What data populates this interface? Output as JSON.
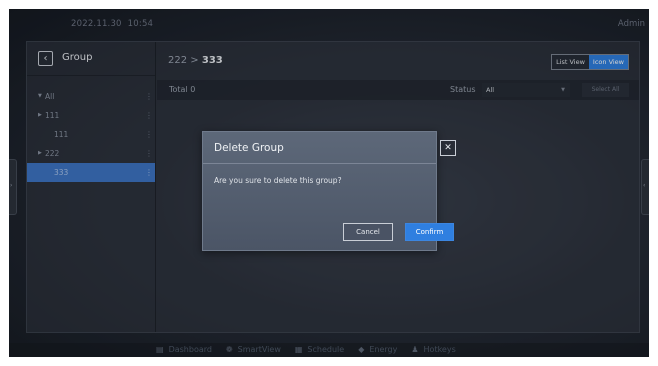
{
  "topbar": {
    "date": "2022.11.30",
    "time": "10:54",
    "user": "Admin"
  },
  "sidebar": {
    "back_icon": "chevron-left-icon",
    "title": "Group",
    "items": [
      {
        "label": "All",
        "expander": "▼",
        "indent": false,
        "selected": false
      },
      {
        "label": "111",
        "expander": "▶",
        "indent": false,
        "selected": false
      },
      {
        "label": "111",
        "expander": "",
        "indent": true,
        "selected": false
      },
      {
        "label": "222",
        "expander": "▶",
        "indent": false,
        "selected": false
      },
      {
        "label": "333",
        "expander": "",
        "indent": true,
        "selected": true
      }
    ],
    "more_glyph": "⋮"
  },
  "content": {
    "breadcrumb_parent": "222",
    "breadcrumb_separator": ">",
    "breadcrumb_current": "333",
    "list_view_label": "List View",
    "icon_view_label": "Icon View",
    "total_label": "Total",
    "total_value": "0",
    "status_label": "Status",
    "status_value": "All",
    "select_all_label": "Select All"
  },
  "dock": {
    "items": [
      {
        "label": "Dashboard",
        "icon": "dashboard-icon",
        "glyph": "▤"
      },
      {
        "label": "SmartView",
        "icon": "smartview-icon",
        "glyph": "❁"
      },
      {
        "label": "Schedule",
        "icon": "schedule-icon",
        "glyph": "▦"
      },
      {
        "label": "Energy",
        "icon": "energy-icon",
        "glyph": "◆"
      },
      {
        "label": "Hotkeys",
        "icon": "hotkeys-icon",
        "glyph": "♟"
      }
    ]
  },
  "dialog": {
    "title": "Delete Group",
    "message": "Are you sure to delete this group?",
    "cancel_label": "Cancel",
    "confirm_label": "Confirm",
    "close_glyph": "✕"
  },
  "colors": {
    "accent": "#2f7fe0",
    "selected_row": "#3d74c4"
  }
}
